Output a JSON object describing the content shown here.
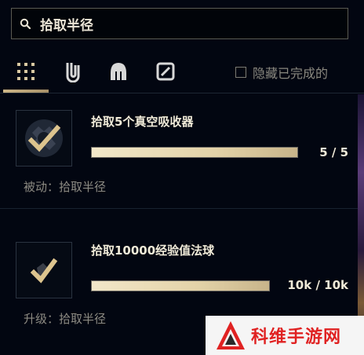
{
  "search": {
    "value": "拾取半径",
    "icon": "search-icon"
  },
  "tabs": [
    {
      "name": "all",
      "icon": "grid-icon",
      "active": true
    },
    {
      "name": "items",
      "icon": "paperclip-icon",
      "active": false
    },
    {
      "name": "helmet",
      "icon": "helmet-icon",
      "active": false
    },
    {
      "name": "slash",
      "icon": "slash-box-icon",
      "active": false
    }
  ],
  "filter": {
    "hide_completed_label": "隐藏已完成的",
    "hide_completed_checked": false
  },
  "missions": [
    {
      "title": "拾取5个真空吸收器",
      "progress_text": "5 / 5",
      "progress": 1.0,
      "description": "被动：拾取半径"
    },
    {
      "title": "拾取10000经验值法球",
      "progress_text": "10k / 10k",
      "progress": 1.0,
      "description": "升级：拾取半径"
    }
  ],
  "watermark": {
    "text": "科维手游网"
  },
  "colors": {
    "background": "#020611",
    "accent_gold": "#cdb687",
    "bar_fill": "#e3d2a8",
    "watermark_red": "#e02222"
  }
}
